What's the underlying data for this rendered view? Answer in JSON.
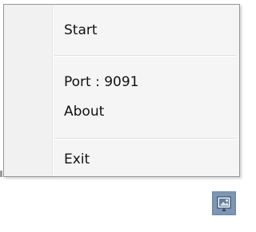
{
  "context_menu": {
    "items": [
      {
        "label": "Start"
      },
      {
        "label": "Port : 9091"
      },
      {
        "label": "About"
      },
      {
        "label": "Exit"
      }
    ]
  },
  "tray": {
    "icon": "app-tray-icon",
    "icon_bg": "#7d97b3"
  }
}
